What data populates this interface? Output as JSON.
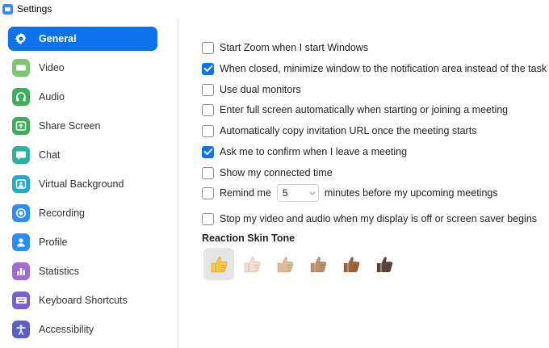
{
  "window": {
    "title": "Settings"
  },
  "sidebar": {
    "items": [
      {
        "label": "General",
        "icon": "gear-icon",
        "color": "#0E72ED",
        "active": true
      },
      {
        "label": "Video",
        "icon": "video-icon",
        "color": "#7BC86C"
      },
      {
        "label": "Audio",
        "icon": "headphones-icon",
        "color": "#3DAE5C"
      },
      {
        "label": "Share Screen",
        "icon": "share-screen-icon",
        "color": "#3DAE5C"
      },
      {
        "label": "Chat",
        "icon": "chat-icon",
        "color": "#2BB39C"
      },
      {
        "label": "Virtual Background",
        "icon": "person-background-icon",
        "color": "#23A9D0"
      },
      {
        "label": "Recording",
        "icon": "record-icon",
        "color": "#2D8CFF"
      },
      {
        "label": "Profile",
        "icon": "profile-icon",
        "color": "#2D8CFF"
      },
      {
        "label": "Statistics",
        "icon": "statistics-icon",
        "color": "#A06BD6"
      },
      {
        "label": "Keyboard Shortcuts",
        "icon": "keyboard-icon",
        "color": "#7B5FCF"
      },
      {
        "label": "Accessibility",
        "icon": "accessibility-icon",
        "color": "#5B5FC7"
      }
    ]
  },
  "general": {
    "options": [
      {
        "label": "Start Zoom when I start Windows",
        "checked": false
      },
      {
        "label": "When closed, minimize window to the notification area instead of the task bar",
        "checked": true
      },
      {
        "label": "Use dual monitors",
        "checked": false
      },
      {
        "label": "Enter full screen automatically when starting or joining a meeting",
        "checked": false
      },
      {
        "label": "Automatically copy invitation URL once the meeting starts",
        "checked": false
      },
      {
        "label": "Ask me to confirm when I leave a meeting",
        "checked": true
      },
      {
        "label": "Show my connected time",
        "checked": false
      }
    ],
    "remind": {
      "label": "Remind me",
      "value": "5",
      "suffix": "minutes before my upcoming meetings",
      "checked": false
    },
    "stop_video": {
      "label": "Stop my video and audio when my display is off or screen saver begins",
      "checked": false
    },
    "reaction": {
      "title": "Reaction Skin Tone",
      "tones": [
        {
          "name": "default",
          "color": "#FFC83D",
          "selected": true
        },
        {
          "name": "light",
          "color": "#F7DECE"
        },
        {
          "name": "medium-light",
          "color": "#E0BB95"
        },
        {
          "name": "medium",
          "color": "#BF8F68"
        },
        {
          "name": "medium-dark",
          "color": "#9B643D"
        },
        {
          "name": "dark",
          "color": "#594539"
        }
      ]
    }
  }
}
